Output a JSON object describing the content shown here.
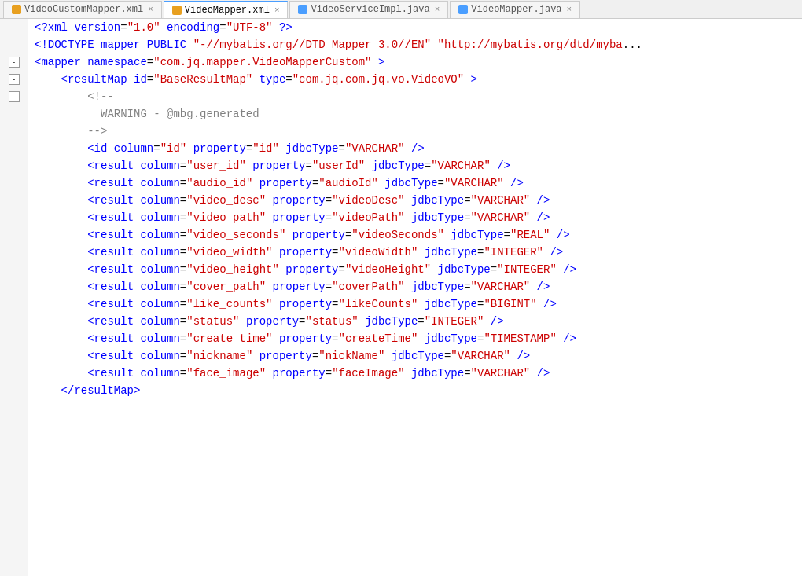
{
  "tabs": [
    {
      "id": "tab1",
      "label": "VideoCustomMapper.xml",
      "icon_color": "#e8a020",
      "active": false,
      "closeable": true
    },
    {
      "id": "tab2",
      "label": "VideoMapper.xml",
      "icon_color": "#e8a020",
      "active": true,
      "closeable": true
    },
    {
      "id": "tab3",
      "label": "VideoServiceImpl.java",
      "icon_color": "#4a9eff",
      "active": false,
      "closeable": true
    },
    {
      "id": "tab4",
      "label": "VideoMapper.java",
      "icon_color": "#4a9eff",
      "active": false,
      "closeable": true
    }
  ],
  "lines": [
    {
      "id": "L1",
      "indent": 0,
      "fold": false,
      "content": "xml_declaration"
    },
    {
      "id": "L2",
      "indent": 0,
      "fold": false,
      "content": "doctype"
    },
    {
      "id": "L3",
      "indent": 0,
      "fold": true,
      "content": "mapper_open"
    },
    {
      "id": "L4",
      "indent": 1,
      "fold": true,
      "content": "resultmap_open"
    },
    {
      "id": "L5",
      "indent": 2,
      "fold": false,
      "content": "comment_open"
    },
    {
      "id": "L6",
      "indent": 3,
      "fold": false,
      "content": "comment_warning"
    },
    {
      "id": "L7",
      "indent": 2,
      "fold": false,
      "content": "comment_close"
    },
    {
      "id": "L8",
      "indent": 2,
      "fold": false,
      "content": "id_element"
    },
    {
      "id": "L9",
      "indent": 2,
      "fold": false,
      "content": "result_userid"
    },
    {
      "id": "L10",
      "indent": 2,
      "fold": false,
      "content": "result_audioid"
    },
    {
      "id": "L11",
      "indent": 2,
      "fold": false,
      "content": "result_videodesc"
    },
    {
      "id": "L12",
      "indent": 2,
      "fold": false,
      "content": "result_videopath"
    },
    {
      "id": "L13",
      "indent": 2,
      "fold": false,
      "content": "result_videoseconds"
    },
    {
      "id": "L14",
      "indent": 2,
      "fold": false,
      "content": "result_videowidth"
    },
    {
      "id": "L15",
      "indent": 2,
      "fold": false,
      "content": "result_videoheight"
    },
    {
      "id": "L16",
      "indent": 2,
      "fold": false,
      "content": "result_coverpath"
    },
    {
      "id": "L17",
      "indent": 2,
      "fold": false,
      "content": "result_likecounts"
    },
    {
      "id": "L18",
      "indent": 2,
      "fold": false,
      "content": "result_status"
    },
    {
      "id": "L19",
      "indent": 2,
      "fold": false,
      "content": "result_createtime"
    },
    {
      "id": "L20",
      "indent": 2,
      "fold": false,
      "content": "result_nickname"
    },
    {
      "id": "L21",
      "indent": 2,
      "fold": false,
      "content": "result_faceimage"
    },
    {
      "id": "L22",
      "indent": 1,
      "fold": false,
      "content": "resultmap_close"
    }
  ],
  "syntax": {
    "xml_declaration": "<?xml version=\"1.0\" encoding=\"UTF-8\" ?>",
    "doctype": "<!DOCTYPE mapper PUBLIC \"-//mybatis.org//DTD Mapper 3.0//EN\" \"http://mybatis.org/dtd/myba...",
    "mapper_open": "<mapper namespace=\"com.jq.mapper.VideoMapperCustom\" >",
    "resultmap_open": "    <resultMap id=\"BaseResultMap\" type=\"com.jq.com.jq.vo.VideoVO\" >",
    "comment_open": "        <!--",
    "comment_warning": "          WARNING - @mbg.generated",
    "comment_close": "        -->",
    "id_element": "        <id column=\"id\" property=\"id\" jdbcType=\"VARCHAR\" />",
    "result_userid": "        <result column=\"user_id\" property=\"userId\" jdbcType=\"VARCHAR\" />",
    "result_audioid": "        <result column=\"audio_id\" property=\"audioId\" jdbcType=\"VARCHAR\" />",
    "result_videodesc": "        <result column=\"video_desc\" property=\"videoDesc\" jdbcType=\"VARCHAR\" />",
    "result_videopath": "        <result column=\"video_path\" property=\"videoPath\" jdbcType=\"VARCHAR\" />",
    "result_videoseconds": "        <result column=\"video_seconds\" property=\"videoSeconds\" jdbcType=\"REAL\" />",
    "result_videowidth": "        <result column=\"video_width\" property=\"videoWidth\" jdbcType=\"INTEGER\" />",
    "result_videoheight": "        <result column=\"video_height\" property=\"videoHeight\" jdbcType=\"INTEGER\" />",
    "result_coverpath": "        <result column=\"cover_path\" property=\"coverPath\" jdbcType=\"VARCHAR\" />",
    "result_likecounts": "        <result column=\"like_counts\" property=\"likeCounts\" jdbcType=\"BIGINT\" />",
    "result_status": "        <result column=\"status\" property=\"status\" jdbcType=\"INTEGER\" />",
    "result_createtime": "        <result column=\"create_time\" property=\"createTime\" jdbcType=\"TIMESTAMP\" />",
    "result_nickname": "        <result column=\"nickname\" property=\"nickName\" jdbcType=\"VARCHAR\" />",
    "result_faceimage": "        <result column=\"face_image\" property=\"faceImage\" jdbcType=\"VARCHAR\" />",
    "resultmap_close": "    </resultMap>"
  },
  "colors": {
    "tag_bracket": "#0000cc",
    "tag_name": "#0000cc",
    "attr_name": "#0000cc",
    "attr_value_string": "#cc0000",
    "attr_value_property": "#cc0000",
    "comment": "#808080",
    "comment_text": "#808080",
    "doctype": "#0000cc",
    "background": "#ffffff",
    "gutter_bg": "#f5f5f5"
  }
}
